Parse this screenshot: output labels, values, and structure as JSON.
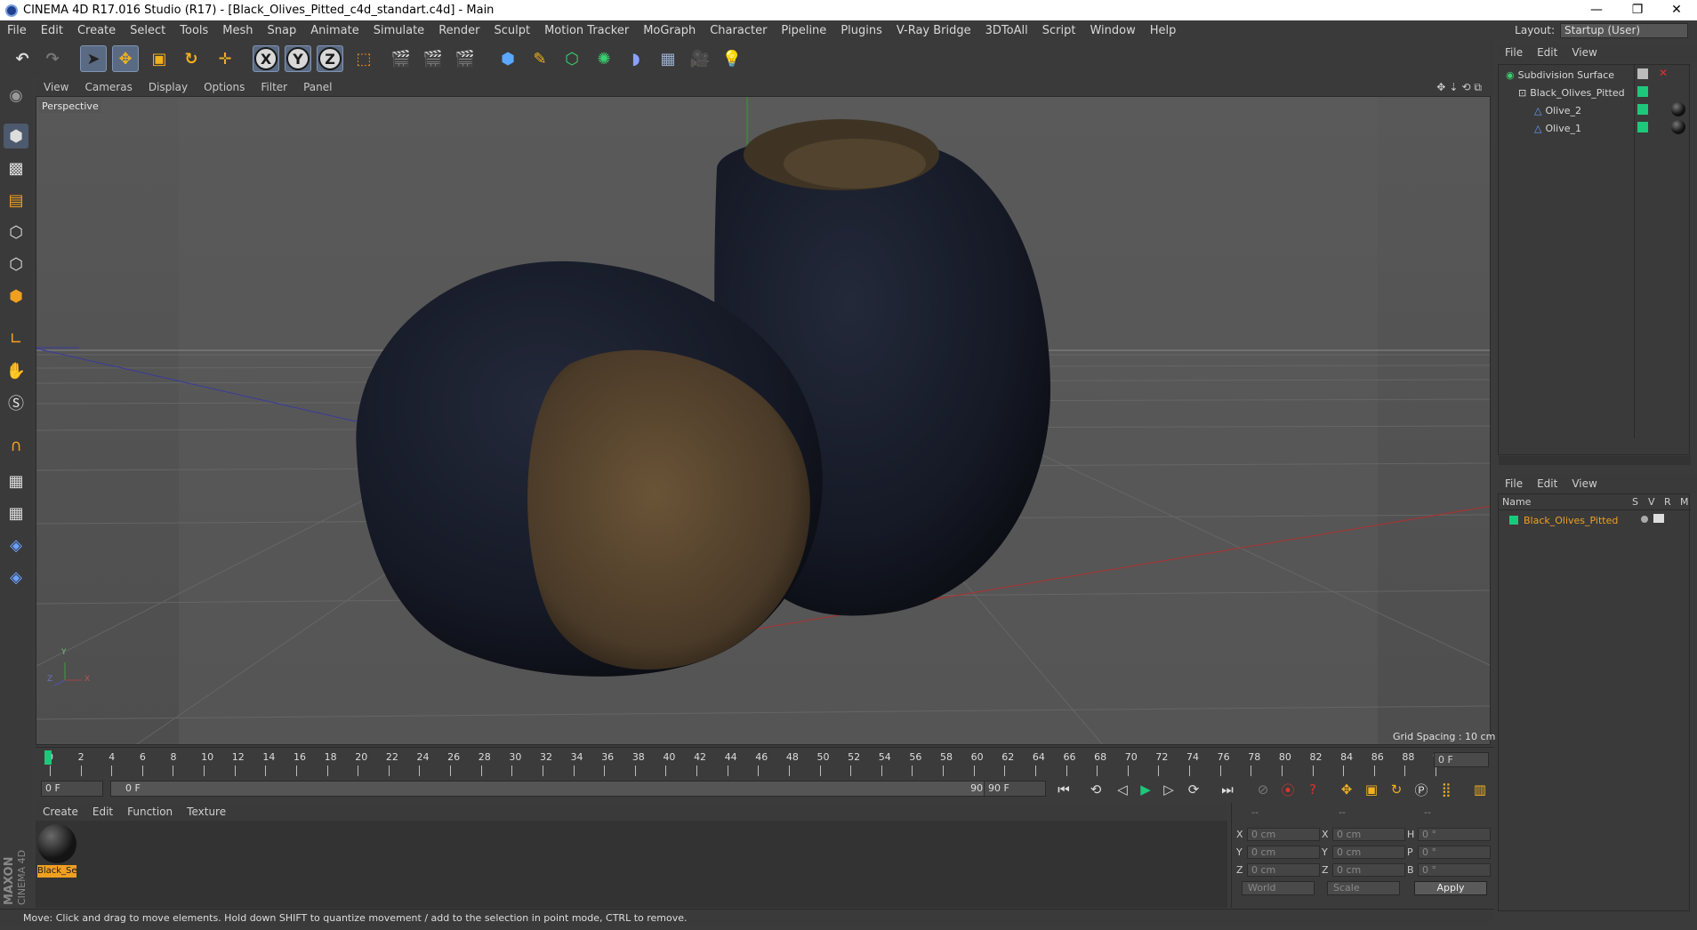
{
  "window": {
    "title": "CINEMA 4D R17.016 Studio (R17) - [Black_Olives_Pitted_c4d_standart.c4d] - Main",
    "min_glyph": "—",
    "max_glyph": "❐",
    "close_glyph": "✕"
  },
  "menu": [
    "File",
    "Edit",
    "Create",
    "Select",
    "Tools",
    "Mesh",
    "Snap",
    "Animate",
    "Simulate",
    "Render",
    "Sculpt",
    "Motion Tracker",
    "MoGraph",
    "Character",
    "Pipeline",
    "Plugins",
    "V-Ray Bridge",
    "3DToAll",
    "Script",
    "Window",
    "Help"
  ],
  "layout": {
    "label": "Layout:",
    "value": "Startup (User)"
  },
  "toolbar": {
    "axis_x": "X",
    "axis_y": "Y",
    "axis_z": "Z"
  },
  "viewport": {
    "menu": [
      "View",
      "Cameras",
      "Display",
      "Options",
      "Filter",
      "Panel"
    ],
    "label": "Perspective",
    "grid_spacing": "Grid Spacing : 10 cm",
    "axis_y": "Y",
    "axis_x": "X",
    "axis_z": "Z"
  },
  "timeline": {
    "ticks": [
      "0",
      "2",
      "4",
      "6",
      "8",
      "10",
      "12",
      "14",
      "16",
      "18",
      "20",
      "22",
      "24",
      "26",
      "28",
      "30",
      "32",
      "34",
      "36",
      "38",
      "40",
      "42",
      "44",
      "46",
      "48",
      "50",
      "52",
      "54",
      "56",
      "58",
      "60",
      "62",
      "64",
      "66",
      "68",
      "70",
      "72",
      "74",
      "76",
      "78",
      "80",
      "82",
      "84",
      "86",
      "88",
      "90"
    ],
    "current_frame": "0 F",
    "start_field": "0 F",
    "range_start": "0 F",
    "range_end": "90 F",
    "end_field": "90 F"
  },
  "material_manager": {
    "menu": [
      "Create",
      "Edit",
      "Function",
      "Texture"
    ],
    "material_name": "Black_Se"
  },
  "coordinates": {
    "header": [
      "--",
      "--",
      "--"
    ],
    "rows": [
      {
        "l1": "X",
        "v1": "0 cm",
        "l2": "X",
        "v2": "0 cm",
        "l3": "H",
        "v3": "0 °"
      },
      {
        "l1": "Y",
        "v1": "0 cm",
        "l2": "Y",
        "v2": "0 cm",
        "l3": "P",
        "v3": "0 °"
      },
      {
        "l1": "Z",
        "v1": "0 cm",
        "l2": "Z",
        "v2": "0 cm",
        "l3": "B",
        "v3": "0 °"
      }
    ],
    "world": "World",
    "scale": "Scale",
    "apply": "Apply"
  },
  "object_manager": {
    "menu": [
      "File",
      "Edit",
      "View"
    ],
    "objects": [
      {
        "name": "Subdivision Surface",
        "indent": 0
      },
      {
        "name": "Black_Olives_Pitted",
        "indent": 1
      },
      {
        "name": "Olive_2",
        "indent": 2
      },
      {
        "name": "Olive_1",
        "indent": 2
      }
    ]
  },
  "layer_manager": {
    "menu": [
      "File",
      "Edit",
      "View"
    ],
    "col_name": "Name",
    "col_s": "S",
    "col_v": "V",
    "col_r": "R",
    "col_m": "M",
    "item": "Black_Olives_Pitted"
  },
  "status": "Move: Click and drag to move elements. Hold down SHIFT to quantize movement / add to the selection in point mode, CTRL to remove.",
  "brand": {
    "maxon": "MAXON",
    "cinema": "CINEMA 4D"
  },
  "colors": {
    "accent_green": "#1ec87a",
    "selection_orange": "#f0a020",
    "background": "#545454"
  }
}
